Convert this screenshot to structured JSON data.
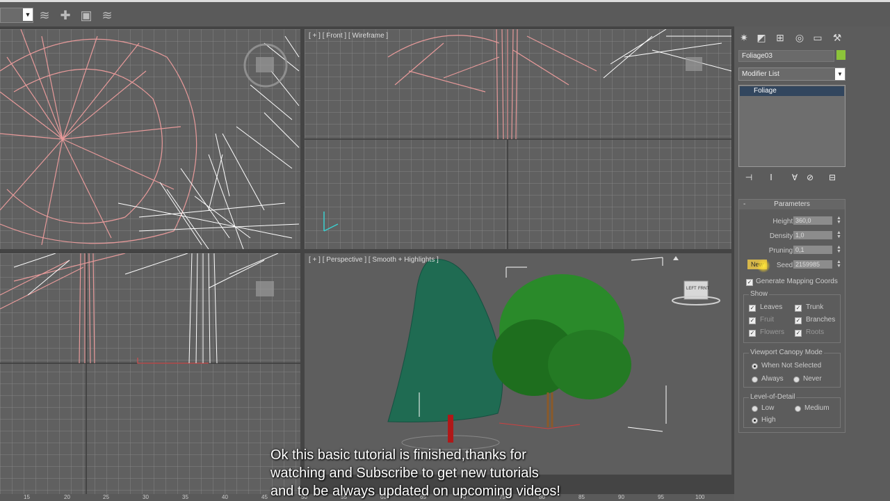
{
  "toolbar": {
    "icons": [
      "link-icon",
      "create-icon",
      "modify-icon",
      "hierarchy-icon"
    ]
  },
  "viewports": {
    "top_left": {
      "label": ""
    },
    "top_right": {
      "label": "[ + ] [ Front ] [ Wireframe ]"
    },
    "bottom_left": {
      "label": ""
    },
    "bottom_right": {
      "label": "[ + ] [ Perspective ] [ Smooth + Highlights ]"
    }
  },
  "viewcube": {
    "left": "LEFT",
    "front": "FRNT"
  },
  "command_panel": {
    "object_name": "Foliage03",
    "object_color": "#8cc43a",
    "modifier_list": "Modifier List",
    "stack_item": "Foliage",
    "parameters": {
      "title": "Parameters",
      "height_label": "Height:",
      "height": "360,0",
      "density_label": "Density:",
      "density": "1,0",
      "pruning_label": "Pruning:",
      "pruning": "0,1",
      "new_label": "New",
      "seed_label": "Seed:",
      "seed": "2159985",
      "mapping": "Generate Mapping Coords",
      "show_title": "Show",
      "leaves": "Leaves",
      "trunk": "Trunk",
      "fruit": "Fruit",
      "branches": "Branches",
      "flowers": "Flowers",
      "roots": "Roots",
      "canopy_title": "Viewport Canopy Mode",
      "when_not_selected": "When Not Selected",
      "always": "Always",
      "never": "Never",
      "lod_title": "Level-of-Detail",
      "low": "Low",
      "medium": "Medium",
      "high": "High"
    }
  },
  "ruler": {
    "ticks": [
      "15",
      "20",
      "25",
      "30",
      "35",
      "40",
      "45",
      "50",
      "55",
      "60",
      "65",
      "70",
      "75",
      "80",
      "85",
      "90",
      "95",
      "100"
    ]
  },
  "subtitle": {
    "line1": "Ok this basic tutorial is finished,thanks for",
    "line2": "watching and Subscribe to get new tutorials",
    "line3": "and to be always updated on upcoming videos!"
  },
  "colors": {
    "accent": "#bba25a",
    "viewport_bg": "#606060",
    "wire_pink": "#e89a9a"
  }
}
